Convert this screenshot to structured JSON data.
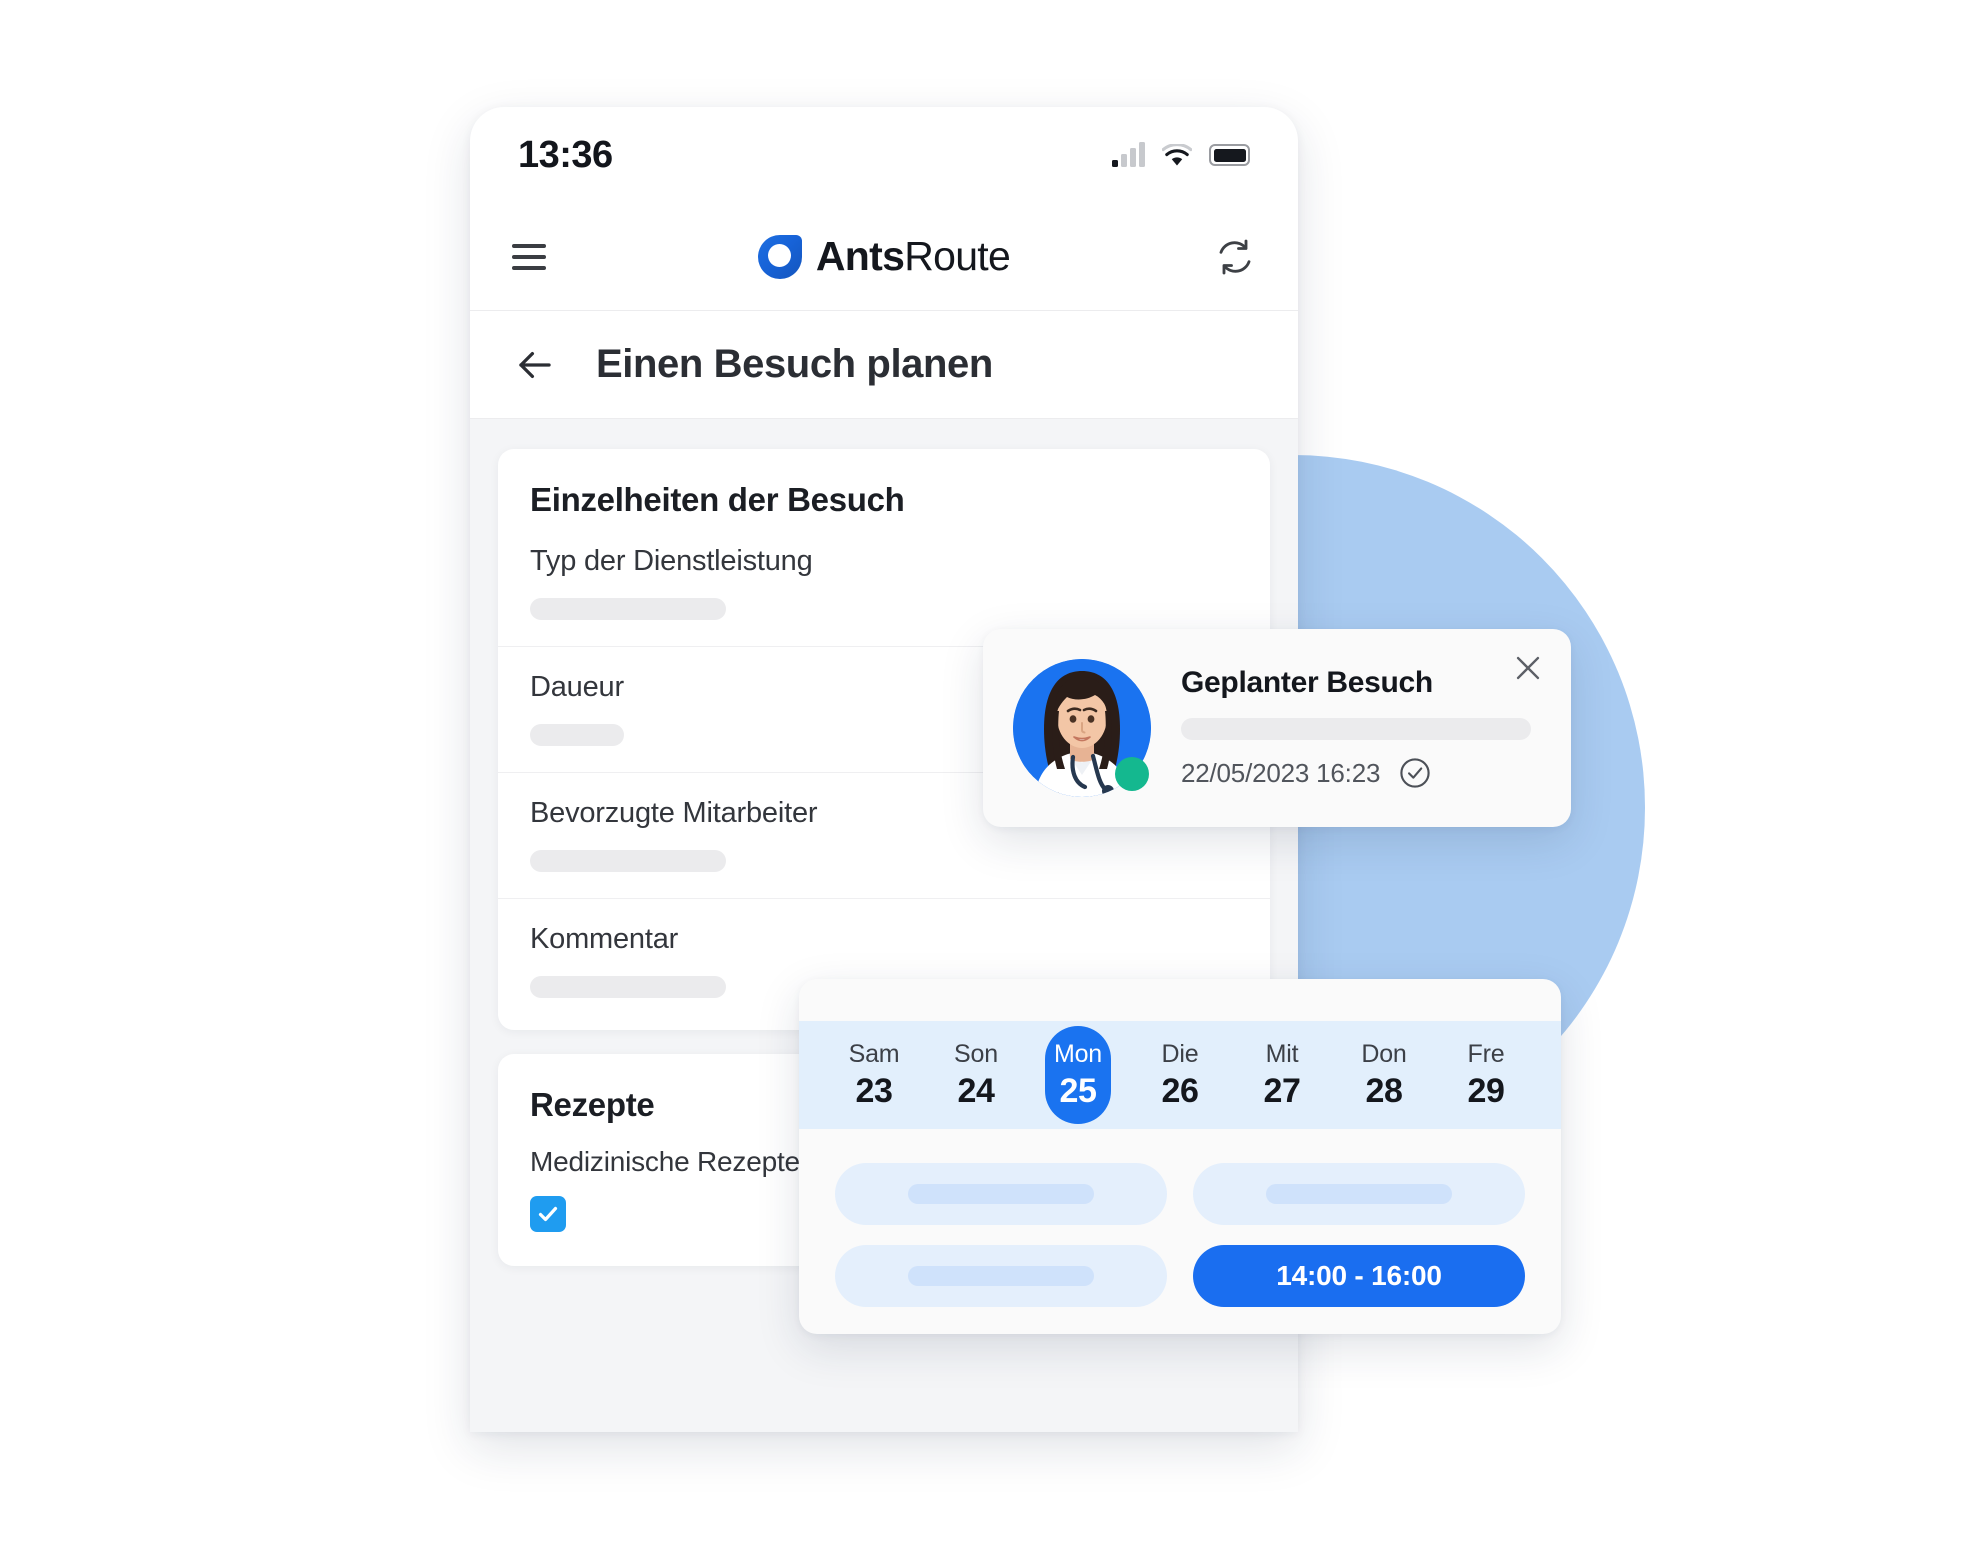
{
  "status_bar": {
    "time": "13:36",
    "signal_icon": "signal-bars-icon",
    "wifi_icon": "wifi-icon",
    "battery_icon": "battery-icon"
  },
  "app_bar": {
    "menu_icon": "hamburger-menu-icon",
    "brand_bold": "Ants",
    "brand_regular": "Route",
    "logo_icon": "antsroute-logo-icon",
    "sync_icon": "sync-refresh-icon"
  },
  "page_header": {
    "back_icon": "back-arrow-icon",
    "title": "Einen Besuch planen"
  },
  "details_card": {
    "title": "Einzelheiten der Besuch",
    "fields": [
      {
        "label": "Typ der Dienstleistung",
        "value_width": "long"
      },
      {
        "label": "Daueur",
        "value_width": "short"
      },
      {
        "label": "Bevorzugte Mitarbeiter",
        "value_width": "long"
      },
      {
        "label": "Kommentar",
        "value_width": "long"
      }
    ]
  },
  "prescriptions_card": {
    "title": "Rezepte",
    "checkbox_label": "Medizinische Rezepte",
    "checkbox_checked": true,
    "check_icon": "checkmark-icon"
  },
  "notification": {
    "title": "Geplanter Besuch",
    "date": "22/05/2023 16:23",
    "status_icon": "check-circle-icon",
    "close_icon": "close-icon",
    "avatar_icon": "doctor-avatar",
    "online_icon": "online-status-dot"
  },
  "calendar": {
    "days": [
      {
        "dow": "Sam",
        "num": "23",
        "selected": false
      },
      {
        "dow": "Son",
        "num": "24",
        "selected": false
      },
      {
        "dow": "Mon",
        "num": "25",
        "selected": true
      },
      {
        "dow": "Die",
        "num": "26",
        "selected": false
      },
      {
        "dow": "Mit",
        "num": "27",
        "selected": false
      },
      {
        "dow": "Don",
        "num": "28",
        "selected": false
      },
      {
        "dow": "Fre",
        "num": "29",
        "selected": false
      }
    ],
    "slots": [
      {
        "label": "",
        "active": false
      },
      {
        "label": "",
        "active": false
      },
      {
        "label": "",
        "active": false
      },
      {
        "label": "14:00 - 16:00",
        "active": true
      }
    ]
  },
  "colors": {
    "brand_blue": "#1a73f0",
    "accent_blue": "#1f9cf0",
    "online_green": "#14b88f",
    "bg_circle_blue": "#a9cbf1",
    "day_strip_blue": "#e2effc",
    "skeleton_gray": "#ebebed"
  }
}
